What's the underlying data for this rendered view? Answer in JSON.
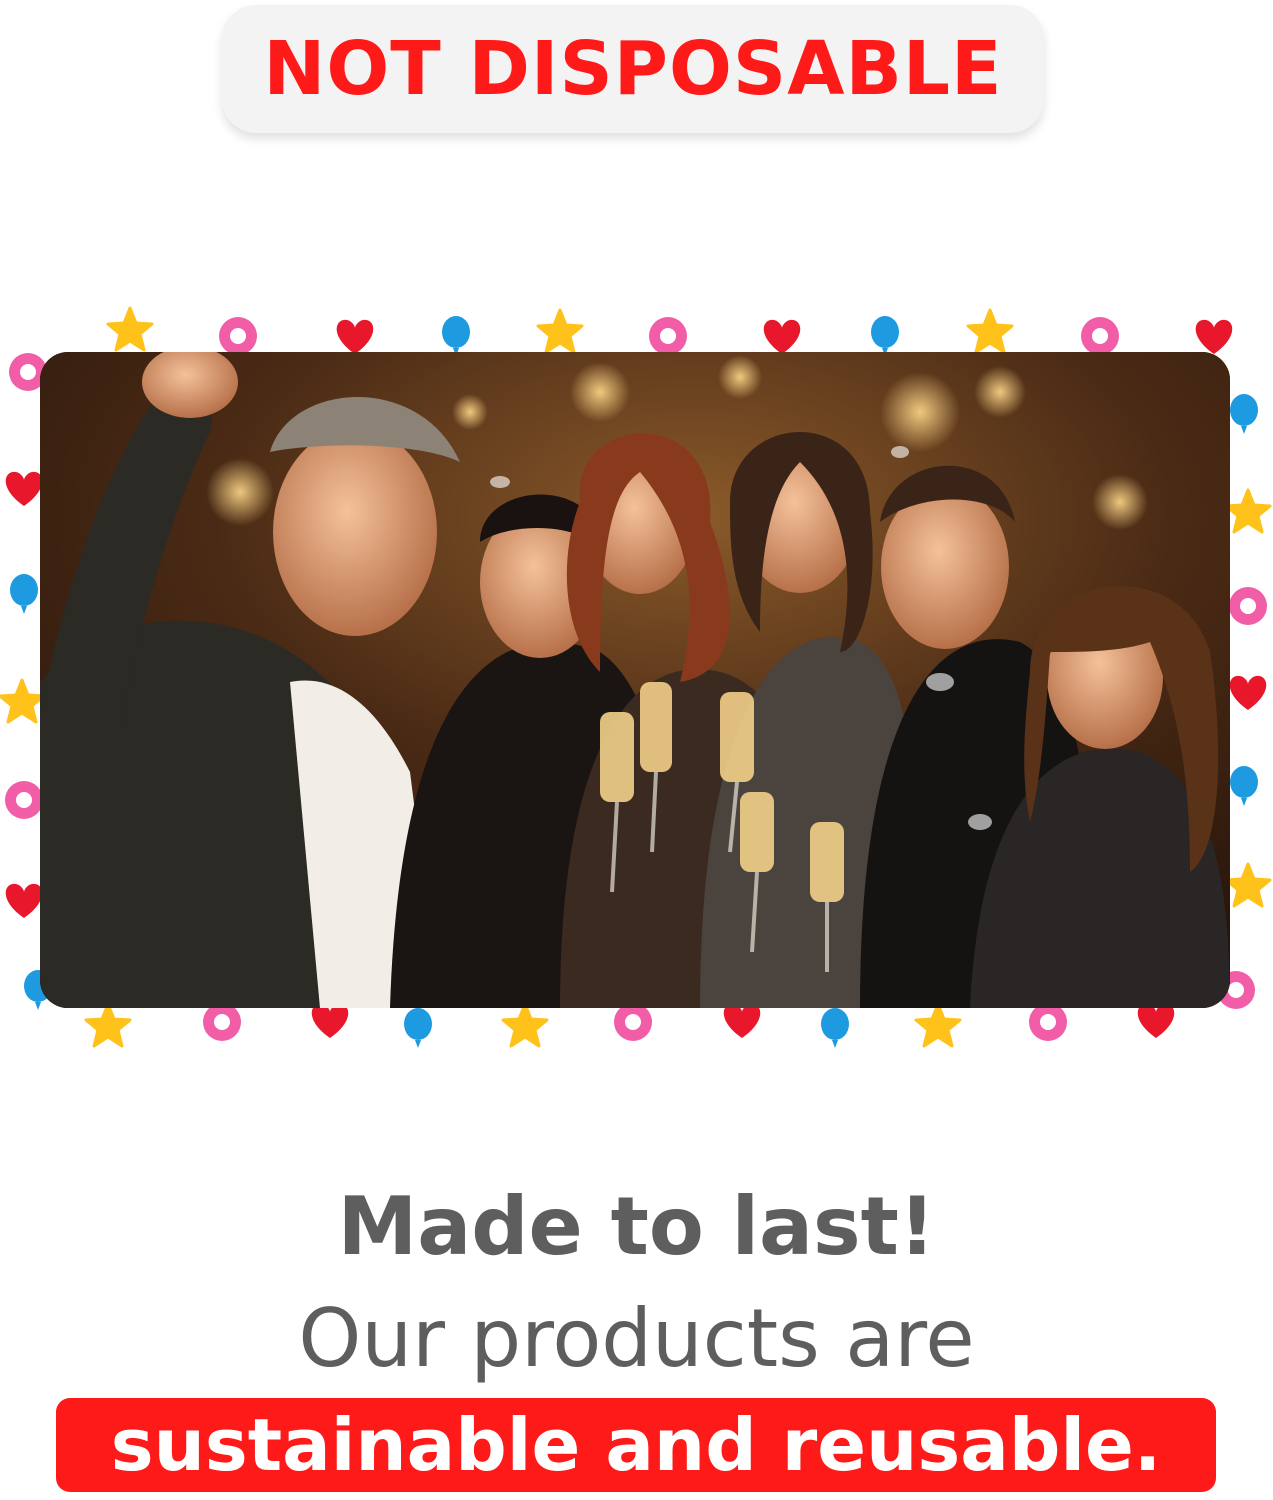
{
  "header": {
    "badge_text": "NOT DISPOSABLE"
  },
  "photo": {
    "subject": "group-selfie-photo"
  },
  "footer": {
    "headline": "Made to last!",
    "line": "Our products are",
    "banner_text": "sustainable and reusable."
  },
  "colors": {
    "accent_red": "#ff1a1a",
    "text_gray": "#5e5e5e",
    "pill_bg": "#f3f3f3",
    "confetti_pink": "#f25da8",
    "confetti_red": "#e8172c",
    "confetti_blue": "#1e9ae0",
    "confetti_yellow": "#ffc21a"
  }
}
